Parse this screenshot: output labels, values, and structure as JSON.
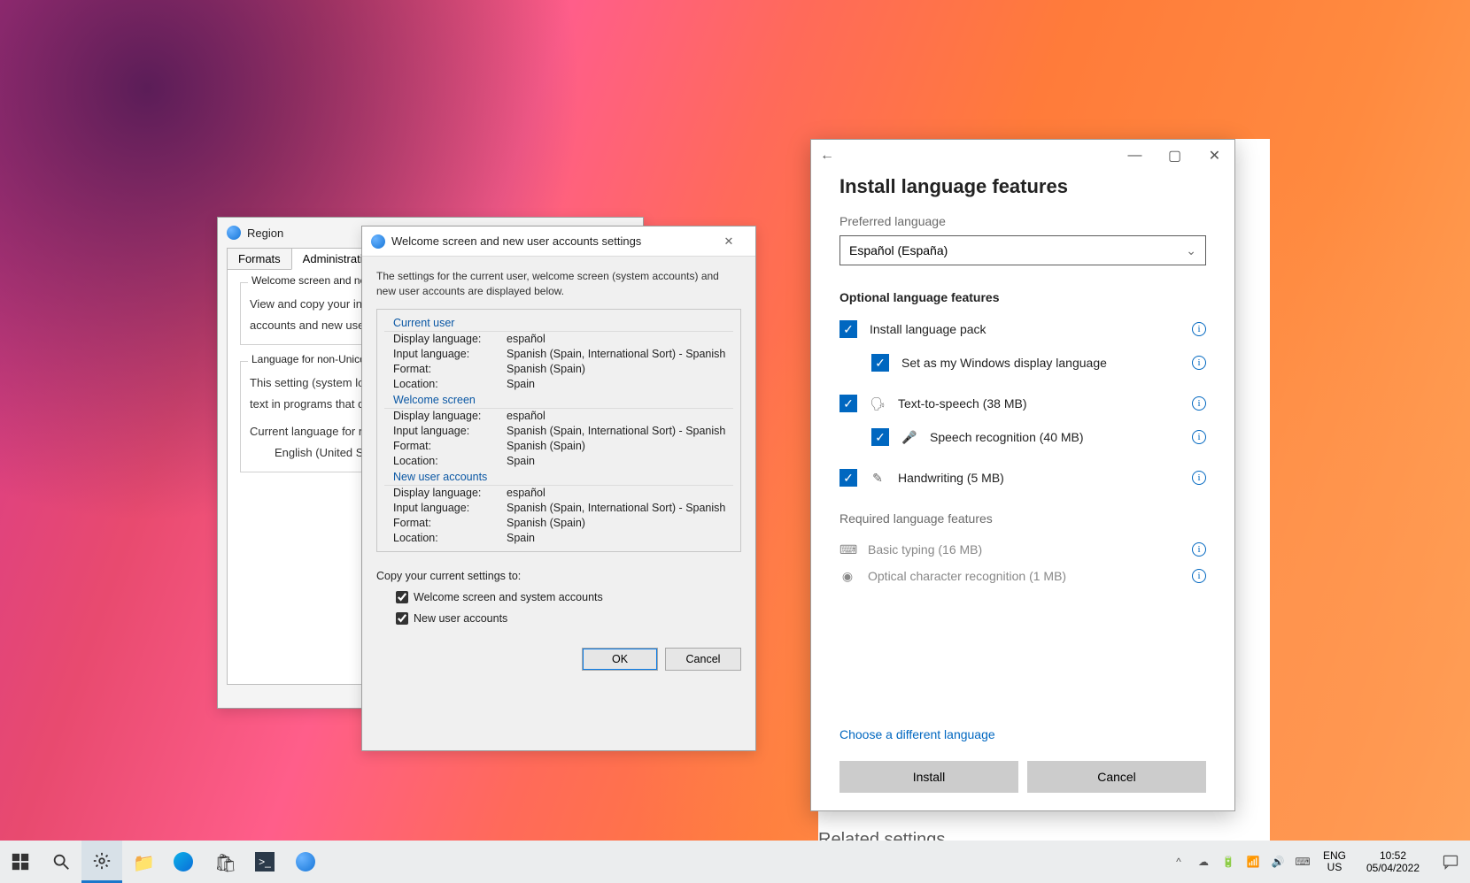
{
  "region": {
    "title": "Region",
    "tabs": {
      "formats": "Formats",
      "administrative": "Administrative"
    },
    "group1": {
      "title": "Welcome screen and new",
      "line1": "View and copy your inte",
      "line2": "accounts and new user a"
    },
    "group2": {
      "title": "Language for non-Unicod",
      "line1": "This setting (system loca",
      "line2": "text in programs that do",
      "curLbl": "Current language for no",
      "curVal": "English (United State"
    }
  },
  "welcome": {
    "title": "Welcome screen and new user accounts settings",
    "desc": "The settings for the current user, welcome screen (system accounts) and new user accounts are displayed below.",
    "sections": {
      "current": "Current user",
      "welcome": "Welcome screen",
      "newuser": "New user accounts"
    },
    "labels": {
      "display": "Display language:",
      "input": "Input language:",
      "format": "Format:",
      "location": "Location:"
    },
    "values": {
      "display": "español",
      "input": "Spanish (Spain, International Sort) - Spanish",
      "format": "Spanish (Spain)",
      "location": "Spain"
    },
    "copyLabel": "Copy your current settings to:",
    "chk1": "Welcome screen and system accounts",
    "chk2": "New user accounts",
    "ok": "OK",
    "cancel": "Cancel"
  },
  "lang": {
    "title": "Install language features",
    "preferred": "Preferred language",
    "selected": "Español (España)",
    "optHeader": "Optional language features",
    "feat": {
      "pack": "Install language pack",
      "setDisplay": "Set as my Windows display language",
      "tts": "Text-to-speech (38 MB)",
      "speech": "Speech recognition (40 MB)",
      "hand": "Handwriting (5 MB)"
    },
    "reqHeader": "Required language features",
    "req": {
      "typing": "Basic typing (16 MB)",
      "ocr": "Optical character recognition (1 MB)"
    },
    "chooseDiff": "Choose a different language",
    "install": "Install",
    "cancel": "Cancel"
  },
  "ghost": {
    "related": "Related settings"
  },
  "tray": {
    "lang1": "ENG",
    "lang2": "US",
    "time": "10:52",
    "date": "05/04/2022"
  }
}
